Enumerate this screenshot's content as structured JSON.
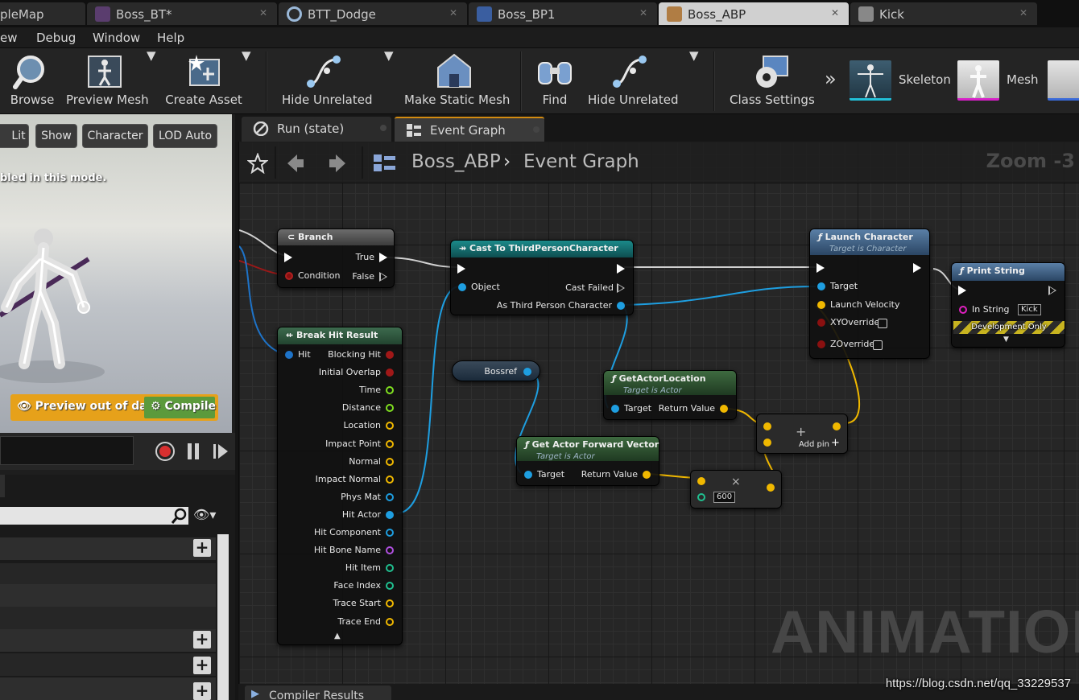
{
  "tabs": [
    {
      "label": "pleMap",
      "color": "#777777"
    },
    {
      "label": "Boss_BT*",
      "color": "#8a4fa0"
    },
    {
      "label": "BTT_Dodge",
      "color": "#4a7aa8"
    },
    {
      "label": "Boss_BP1",
      "color": "#4a6fb0"
    },
    {
      "label": "Boss_ABP",
      "color": "#c98a3a",
      "active": true
    },
    {
      "label": "Kick",
      "color": "#8a8a8a"
    }
  ],
  "menu": [
    "ew",
    "Debug",
    "Window",
    "Help"
  ],
  "toolbar": {
    "browse": "Browse",
    "preview_mesh": "Preview Mesh",
    "create_asset": "Create Asset",
    "hide_unrelated_1": "Hide Unrelated",
    "make_static_mesh": "Make Static Mesh",
    "find": "Find",
    "hide_unrelated_2": "Hide Unrelated",
    "class_settings": "Class Settings",
    "skeleton": "Skeleton",
    "mesh": "Mesh"
  },
  "viewport": {
    "lit": "Lit",
    "show": "Show",
    "character": "Character",
    "lod": "LOD Auto",
    "note": "bled in this mode.",
    "preview_out_of_date": "Preview out of date",
    "compile": "Compile"
  },
  "graph_tabs": [
    {
      "label": "Run (state)"
    },
    {
      "label": "Event Graph",
      "active": true
    }
  ],
  "breadcrumb": {
    "asset": "Boss_ABP",
    "graph": "Event Graph",
    "zoom": "Zoom -3"
  },
  "watermark": "ANIMATION",
  "compiler_tab": "Compiler Results",
  "url": "https://blog.csdn.net/qq_33229537",
  "nodes": {
    "branch": {
      "title": "Branch",
      "true": "True",
      "condition": "Condition",
      "false": "False"
    },
    "cast": {
      "title": "Cast To ThirdPersonCharacter",
      "object": "Object",
      "cast_failed": "Cast Failed",
      "as": "As Third Person Character"
    },
    "break_hit": {
      "title": "Break Hit Result",
      "hit": "Hit",
      "outputs": [
        "Blocking Hit",
        "Initial Overlap",
        "Time",
        "Distance",
        "Location",
        "Impact Point",
        "Normal",
        "Impact Normal",
        "Phys Mat",
        "Hit Actor",
        "Hit Component",
        "Hit Bone Name",
        "Hit Item",
        "Face Index",
        "Trace Start",
        "Trace End"
      ]
    },
    "bossref": {
      "title": "Bossref"
    },
    "get_location": {
      "title": "GetActorLocation",
      "sub": "Target is Actor",
      "target": "Target",
      "ret": "Return Value"
    },
    "forward": {
      "title": "Get Actor Forward Vector",
      "sub": "Target is Actor",
      "target": "Target",
      "ret": "Return Value"
    },
    "launch": {
      "title": "Launch Character",
      "sub": "Target is Character",
      "target": "Target",
      "velocity": "Launch Velocity",
      "xy": "XYOverride",
      "z": "ZOverride"
    },
    "print": {
      "title": "Print String",
      "in_string": "In String",
      "value": "Kick",
      "dev": "Development Only"
    },
    "add": {
      "add_pin": "Add pin"
    },
    "multiply": {
      "value": "600"
    }
  }
}
